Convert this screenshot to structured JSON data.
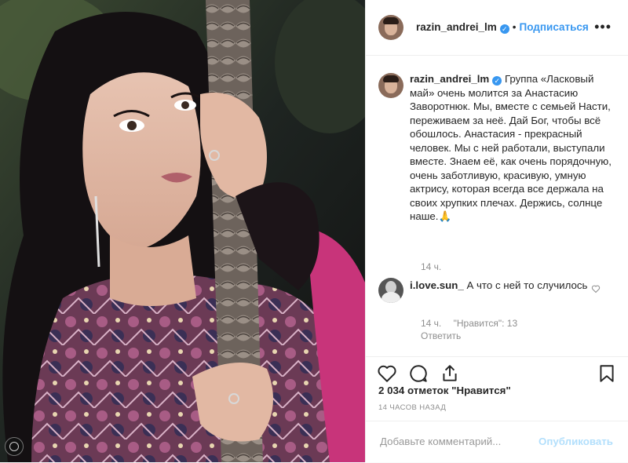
{
  "post": {
    "username": "razin_andrei_lm",
    "verified": true,
    "follow_label": "Подписаться",
    "separator": "•",
    "more_label": "•••"
  },
  "caption": {
    "username": "razin_andrei_lm",
    "text": "Группа «Ласковый май» очень молится за Анастасию Заворотнюк. Мы, вместе с семьей Насти, переживаем за неё. Дай Бог, чтобы всё обошлось. Анастасия - прекрасный человек. Мы с ней работали, выступали вместе. Знаем её, как очень порядочную, очень заботливую, красивую, умную актрису, которая всегда все держала на своих хрупких плечах. Держись, солнце наше.🙏",
    "time": "14 ч."
  },
  "comment": {
    "username": "i.love.sun_",
    "text": "А что с ней то случилось",
    "time": "14 ч.",
    "likes": "\"Нравится\": 13",
    "reply_label": "Ответить"
  },
  "stats": {
    "likes_count": "2 034 отметок",
    "likes_word": "\"Нравится\"",
    "ago": "14 ЧАСОВ НАЗАД"
  },
  "add_comment": {
    "placeholder": "Добавьте комментарий...",
    "publish_label": "Опубликовать"
  },
  "icons": {
    "like": "heart-icon",
    "comment": "comment-icon",
    "share": "share-icon",
    "save": "bookmark-icon",
    "comment_like": "heart-small-icon"
  },
  "colors": {
    "accent": "#3897f0",
    "muted": "#8e8e8e",
    "publish_disabled": "#b2dffc"
  }
}
